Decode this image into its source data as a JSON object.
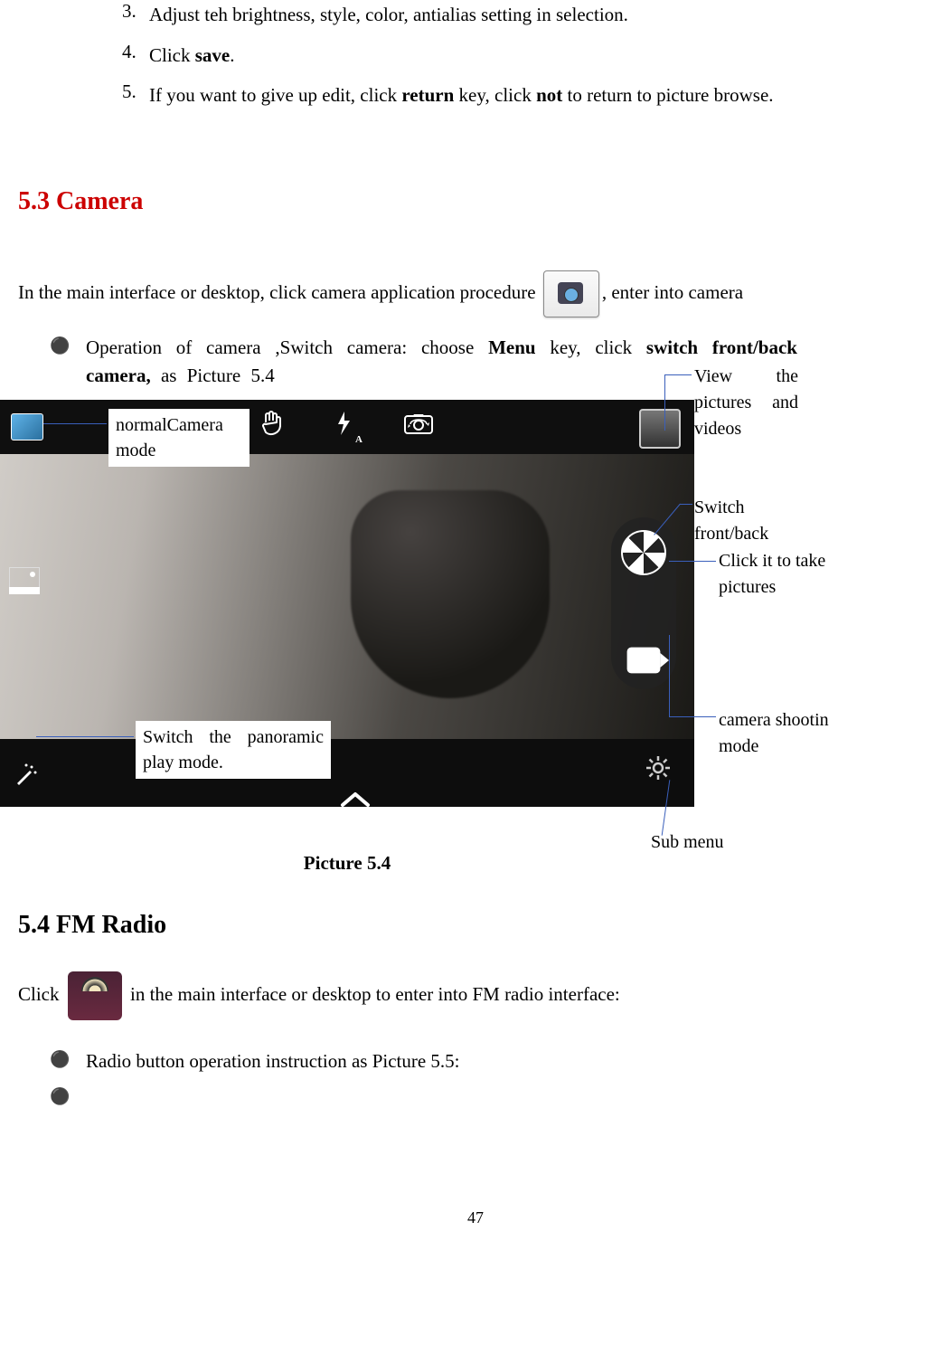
{
  "steps": [
    {
      "num": "3.",
      "text_before": "Adjust teh brightness, style, color, antialias setting in selection.",
      "bold1": "",
      "mid": "",
      "bold2": "",
      "after": ""
    },
    {
      "num": "4.",
      "text_before": "Click ",
      "bold1": "save",
      "mid": ".",
      "bold2": "",
      "after": ""
    },
    {
      "num": "5.",
      "text_before": "If you want to give up edit, click ",
      "bold1": "return",
      "mid": " key, click ",
      "bold2": "not",
      "after": " to return to picture browse."
    }
  ],
  "section_camera": "5.3 Camera",
  "camera_intro_before": "In the main interface or desktop, click camera application procedure",
  "camera_intro_after": ",  enter into camera",
  "camera_bullet_before": "Operation of camera ,Switch camera: choose ",
  "camera_bullet_bold1": "Menu",
  "camera_bullet_mid": " key, click ",
  "camera_bullet_bold2": "switch front/back camera,",
  "camera_bullet_after": " as Picture 5.4",
  "ann": {
    "normal": "normalCamera mode",
    "panoramic": "Switch the panoramic play mode.",
    "view": "View the pictures and videos",
    "switchfb": "Switch front/back",
    "take": "Click it to take pictures",
    "shootin": "camera shootin mode",
    "submenu": "Sub menu"
  },
  "caption": "Picture 5.4",
  "section_radio": "5.4 FM Radio",
  "radio_before": "Click ",
  "radio_after": " in the main interface or desktop to enter into FM radio interface:",
  "radio_bullet": "Radio button operation instruction as Picture 5.5:",
  "page_number": "47"
}
